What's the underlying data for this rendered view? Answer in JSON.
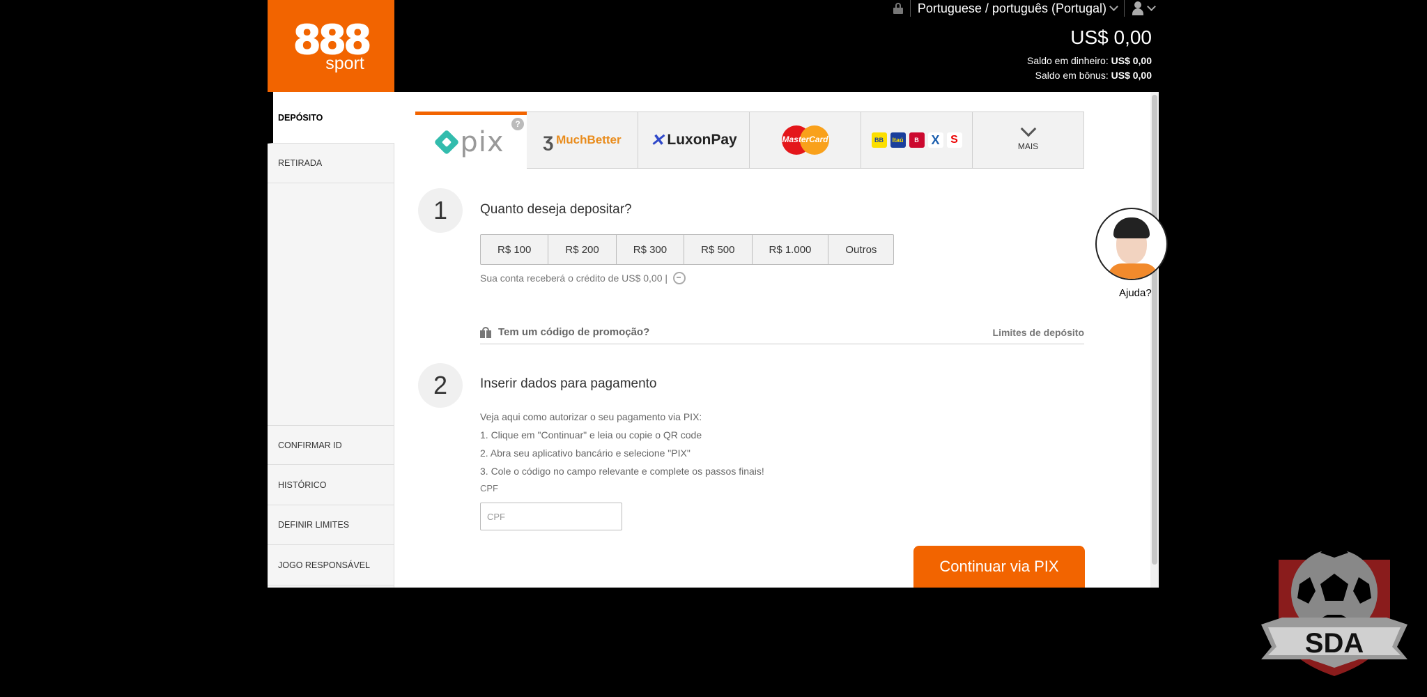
{
  "header": {
    "logo_number": "888",
    "logo_sub": "sport",
    "language": "Portuguese / português (Portugal)",
    "balance": "US$ 0,00",
    "cash_balance_label": "Saldo em dinheiro:",
    "cash_balance_value": "US$ 0,00",
    "bonus_balance_label": "Saldo em bônus:",
    "bonus_balance_value": "US$ 0,00"
  },
  "sidebar": {
    "items": [
      {
        "label": "DEPÓSITO",
        "active": true
      },
      {
        "label": "RETIRADA"
      },
      {
        "label": "CONFIRMAR ID"
      },
      {
        "label": "HISTÓRICO"
      },
      {
        "label": "DEFINIR LIMITES"
      },
      {
        "label": "JOGO RESPONSÁVEL"
      }
    ]
  },
  "payment_methods": {
    "pix": "pix",
    "pix_help": "?",
    "muchbetter": "MuchBetter",
    "luxonpay": "LuxonPay",
    "mastercard": "MasterCard",
    "banks": [
      "BB",
      "Itaú",
      "B",
      "X",
      "S"
    ],
    "more": "MAIS"
  },
  "step1": {
    "number": "1",
    "title": "Quanto deseja depositar?",
    "amounts": [
      "R$ 100",
      "R$ 200",
      "R$ 300",
      "R$ 500",
      "R$ 1.000",
      "Outros"
    ],
    "credit_text": "Sua conta receberá o crédito de US$ 0,00 |",
    "promo_label": "Tem um código de promoção?",
    "limits_link": "Limites de depósito"
  },
  "step2": {
    "number": "2",
    "title": "Inserir dados para pagamento",
    "instructions": [
      "Veja aqui como autorizar o seu pagamento via PIX:",
      "1. Clique em \"Continuar\" e leia ou copie o QR code",
      "2. Abra seu aplicativo bancário e selecione \"PIX\"",
      "3. Cole o código no campo relevante e complete os passos finais!"
    ],
    "cpf_label": "CPF",
    "cpf_placeholder": "CPF",
    "continue_label": "Continuar via PIX"
  },
  "help": {
    "label": "Ajuda?"
  },
  "watermark": {
    "text": "SDA"
  },
  "colors": {
    "brand_orange": "#f26400",
    "pix_teal": "#32bcad"
  }
}
